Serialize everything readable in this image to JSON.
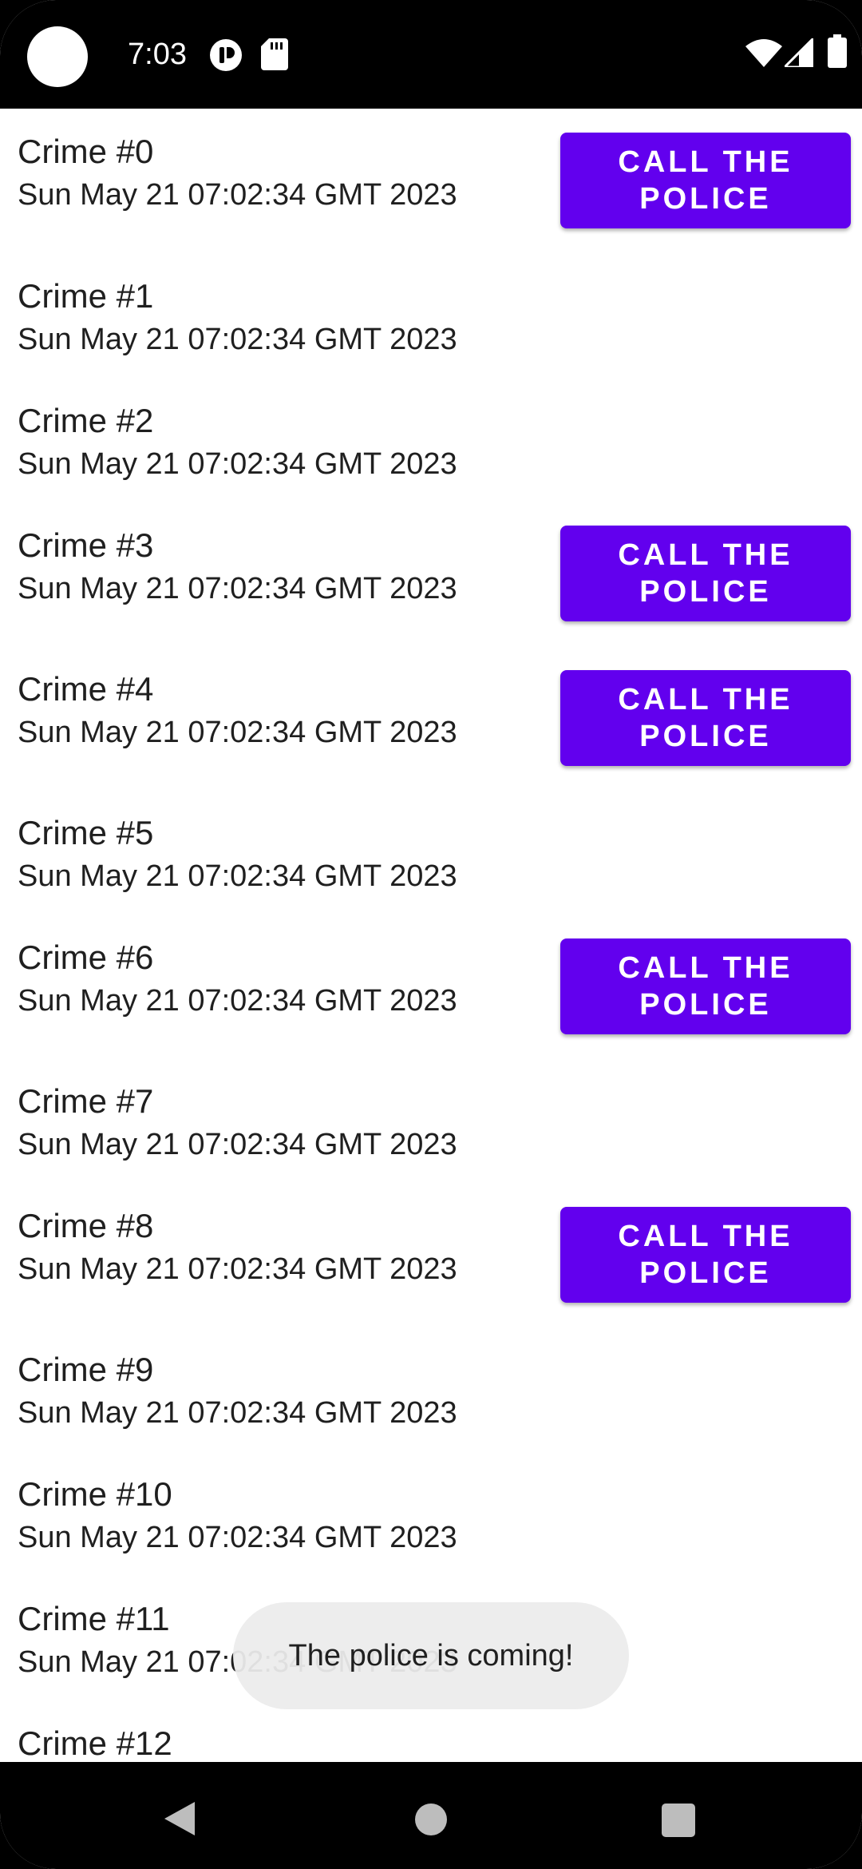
{
  "status_bar": {
    "time": "7:03",
    "icons": [
      "camera-cutout",
      "notification-icon",
      "sd-card-icon",
      "wifi-icon",
      "signal-icon",
      "battery-icon"
    ]
  },
  "crimes": [
    {
      "title": "Crime #0",
      "date": "Sun May 21 07:02:34 GMT 2023",
      "button": "CALL THE POLICE"
    },
    {
      "title": "Crime #1",
      "date": "Sun May 21 07:02:34 GMT 2023"
    },
    {
      "title": "Crime #2",
      "date": "Sun May 21 07:02:34 GMT 2023"
    },
    {
      "title": "Crime #3",
      "date": "Sun May 21 07:02:34 GMT 2023",
      "button": "CALL THE POLICE"
    },
    {
      "title": "Crime #4",
      "date": "Sun May 21 07:02:34 GMT 2023",
      "button": "CALL THE POLICE"
    },
    {
      "title": "Crime #5",
      "date": "Sun May 21 07:02:34 GMT 2023"
    },
    {
      "title": "Crime #6",
      "date": "Sun May 21 07:02:34 GMT 2023",
      "button": "CALL THE POLICE"
    },
    {
      "title": "Crime #7",
      "date": "Sun May 21 07:02:34 GMT 2023"
    },
    {
      "title": "Crime #8",
      "date": "Sun May 21 07:02:34 GMT 2023",
      "button": "CALL THE POLICE"
    },
    {
      "title": "Crime #9",
      "date": "Sun May 21 07:02:34 GMT 2023"
    },
    {
      "title": "Crime #10",
      "date": "Sun May 21 07:02:34 GMT 2023"
    },
    {
      "title": "Crime #11",
      "date": "Sun May 21 07:02:34 GMT 2023"
    },
    {
      "title": "Crime #12",
      "date": ""
    }
  ],
  "toast": {
    "message": "The police is coming!"
  },
  "colors": {
    "accent": "#6200EE",
    "background": "#FFFFFF",
    "bars": "#000000"
  },
  "nav_bar": {
    "icons": [
      "back-icon",
      "home-icon",
      "recents-icon"
    ]
  }
}
